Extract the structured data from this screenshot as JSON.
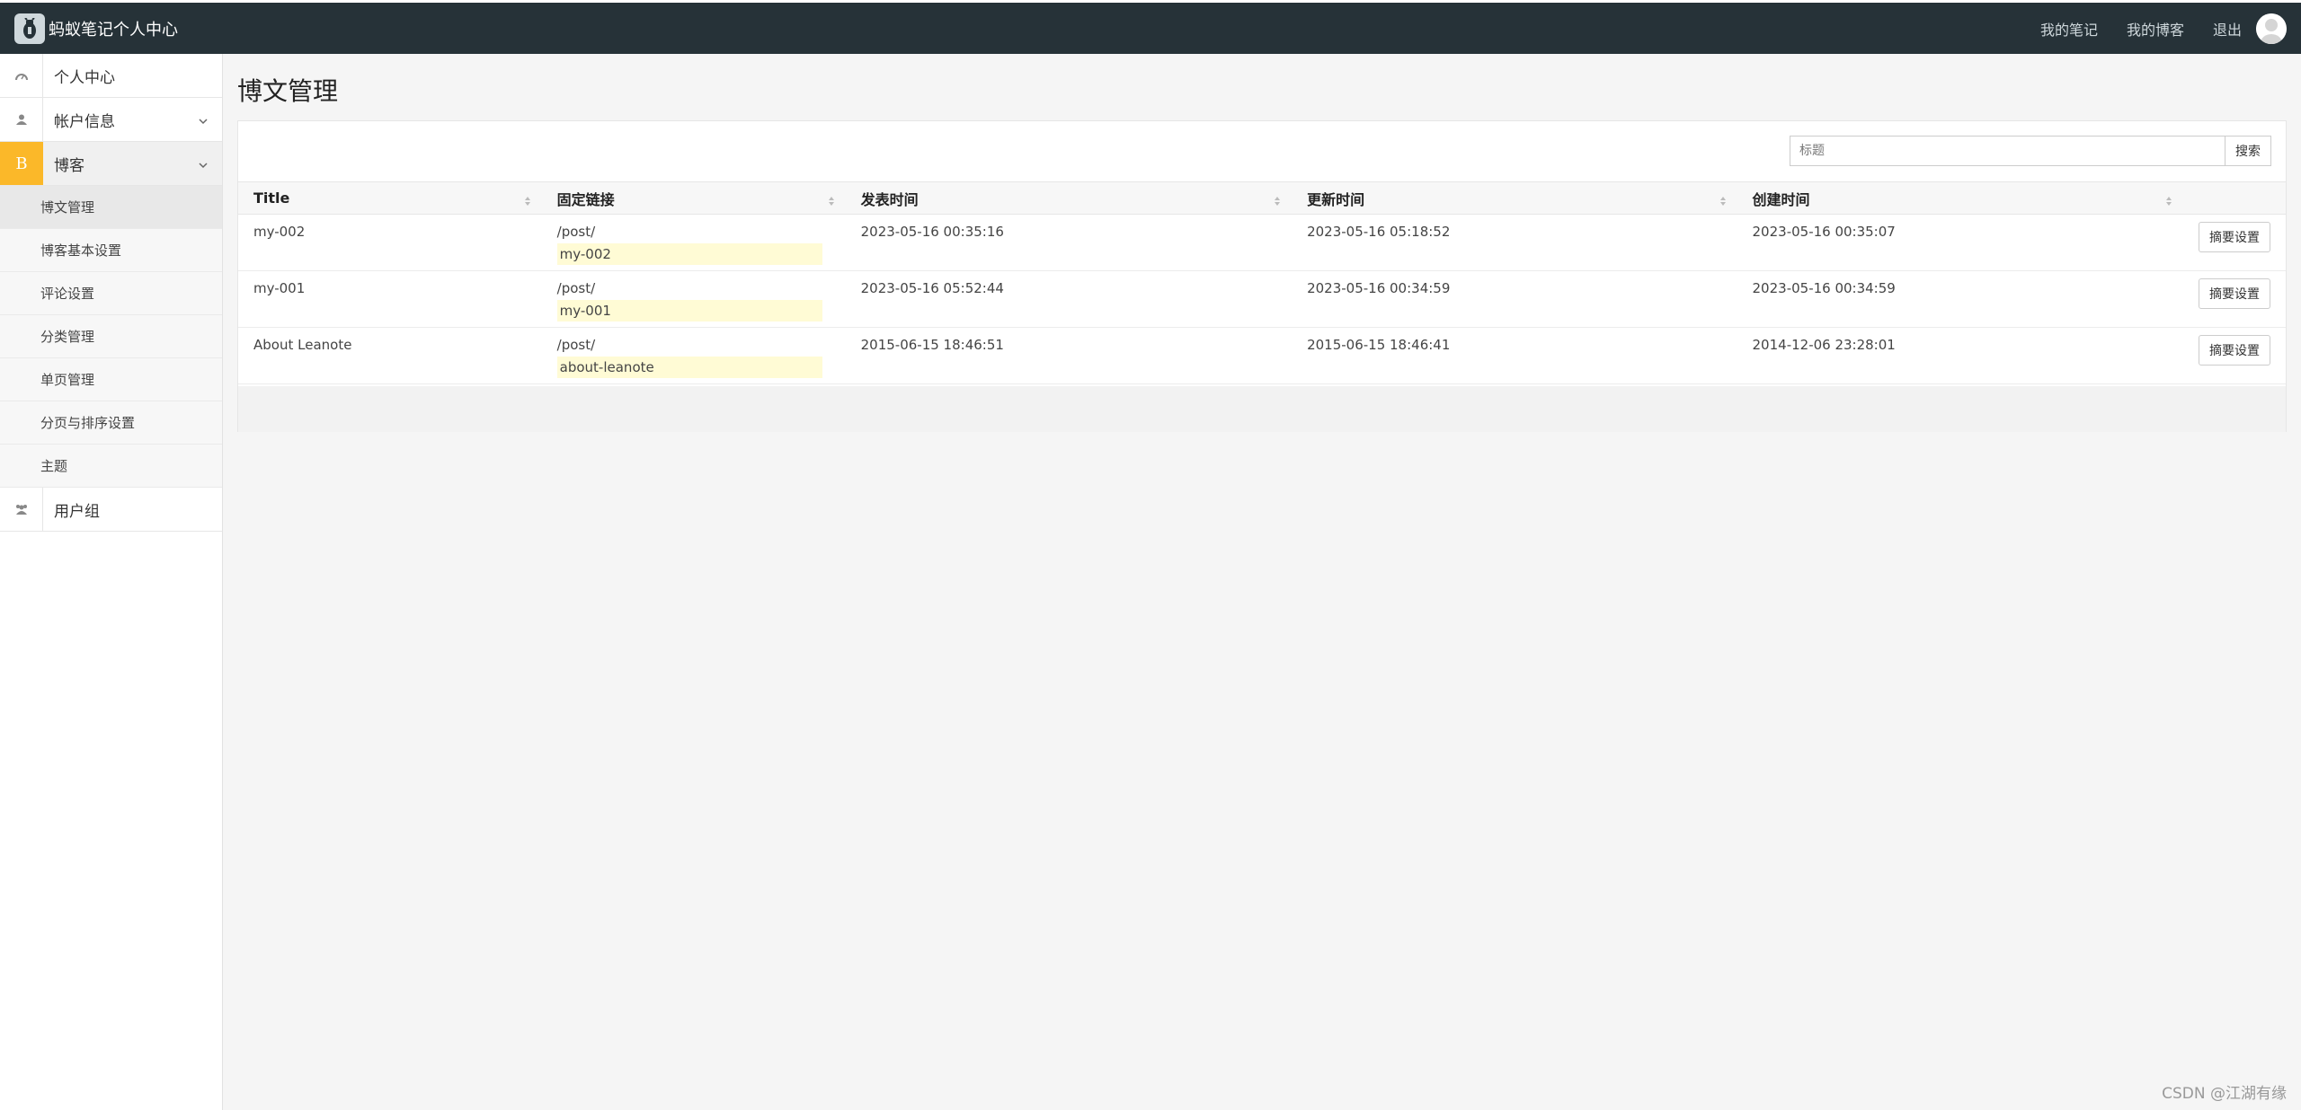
{
  "app": {
    "title": "蚂蚁笔记个人中心"
  },
  "topnav": {
    "my_notes": "我的笔记",
    "my_blog": "我的博客",
    "logout": "退出"
  },
  "sidebar": {
    "items": [
      {
        "label": "个人中心",
        "icon": "dashboard-icon"
      },
      {
        "label": "帐户信息",
        "icon": "user-icon"
      },
      {
        "label": "博客",
        "icon": "blog-icon",
        "icon_text": "B"
      },
      {
        "label": "用户组",
        "icon": "group-icon"
      }
    ],
    "blog_sub": [
      "博文管理",
      "博客基本设置",
      "评论设置",
      "分类管理",
      "单页管理",
      "分页与排序设置",
      "主题"
    ]
  },
  "page": {
    "title": "博文管理"
  },
  "search": {
    "placeholder": "标题",
    "button": "搜索"
  },
  "table": {
    "headers": [
      "Title",
      "固定链接",
      "发表时间",
      "更新时间",
      "创建时间"
    ],
    "rows": [
      {
        "title": "my-002",
        "prefix": "/post/",
        "slug": "my-002",
        "published": "2023-05-16 00:35:16",
        "updated": "2023-05-16 05:18:52",
        "created": "2023-05-16 00:35:07",
        "action": "摘要设置"
      },
      {
        "title": "my-001",
        "prefix": "/post/",
        "slug": "my-001",
        "published": "2023-05-16 05:52:44",
        "updated": "2023-05-16 00:34:59",
        "created": "2023-05-16 00:34:59",
        "action": "摘要设置"
      },
      {
        "title": "About Leanote",
        "prefix": "/post/",
        "slug": "about-leanote",
        "published": "2015-06-15 18:46:51",
        "updated": "2015-06-15 18:46:41",
        "created": "2014-12-06 23:28:01",
        "action": "摘要设置"
      }
    ]
  },
  "watermark": "CSDN @江湖有缘",
  "colors": {
    "topbar": "#263238",
    "accent": "#fbb829",
    "slug_bg": "#fffbd5"
  }
}
